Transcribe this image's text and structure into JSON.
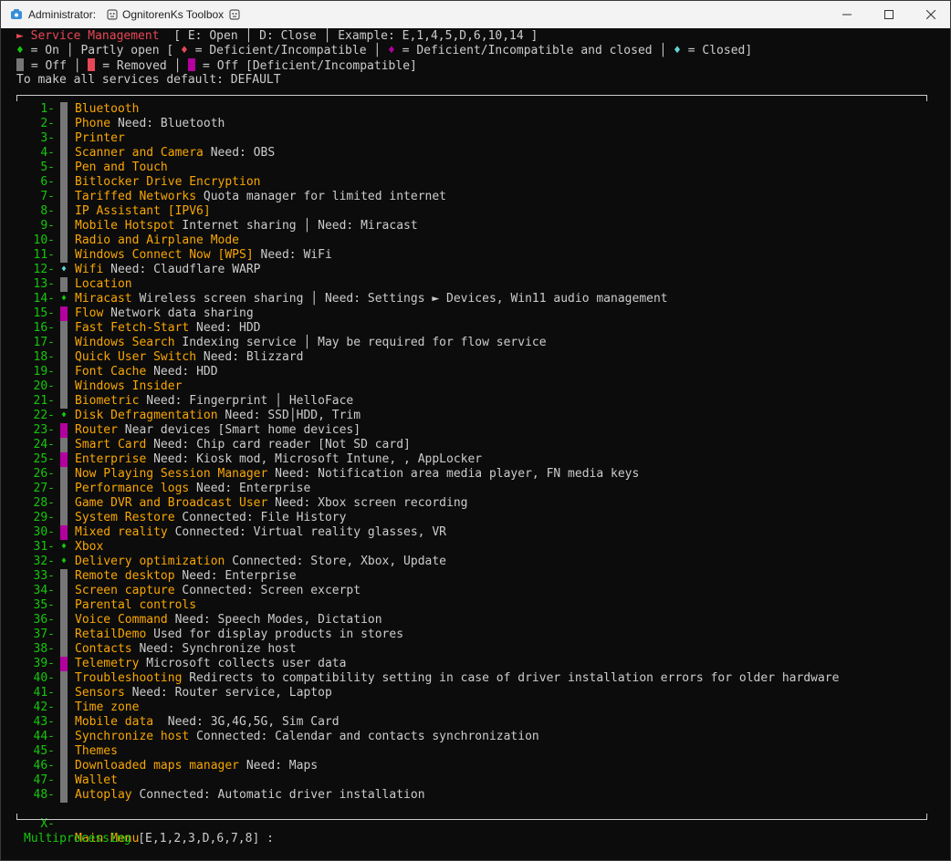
{
  "titlebar": {
    "admin_label": "Administrator:",
    "title": "OgnitorenKs Toolbox"
  },
  "header": {
    "arrow": "►",
    "title": "Service Management",
    "hint": "[ E: Open │ D: Close │ Example: E,1,4,5,D,6,10,14 ]",
    "legend1": {
      "on_sym": "♦",
      "on": "= On",
      "sep1": "│",
      "partly": "Partly open [",
      "def_sym": "♦",
      "def": "= Deficient/Incompatible",
      "sep2": "│",
      "defc_sym": "♦",
      "defc": "= Deficient/Incompatible and closed",
      "sep3": "│",
      "closed_sym": "♦",
      "closed": "= Closed]"
    },
    "legend2": {
      "off": "= Off",
      "sep1": "│",
      "removed": "= Removed",
      "sep2": "│",
      "offdef": "= Off [Deficient/Incompatible]"
    },
    "default_line": "To make all services default: DEFAULT"
  },
  "services": [
    {
      "num": "1-",
      "marker": "gray",
      "name": "Bluetooth",
      "desc": ""
    },
    {
      "num": "2-",
      "marker": "gray",
      "name": "Phone",
      "desc": " Need: Bluetooth"
    },
    {
      "num": "3-",
      "marker": "gray",
      "name": "Printer",
      "desc": ""
    },
    {
      "num": "4-",
      "marker": "gray",
      "name": "Scanner and Camera",
      "desc": " Need: OBS"
    },
    {
      "num": "5-",
      "marker": "gray",
      "name": "Pen and Touch",
      "desc": ""
    },
    {
      "num": "6-",
      "marker": "gray",
      "name": "Bitlocker Drive Encryption",
      "desc": ""
    },
    {
      "num": "7-",
      "marker": "gray",
      "name": "Tariffed Networks",
      "desc": " Quota manager for limited internet"
    },
    {
      "num": "8-",
      "marker": "gray",
      "name": "IP Assistant [IPV6]",
      "desc": ""
    },
    {
      "num": "9-",
      "marker": "gray",
      "name": "Mobile Hotspot",
      "desc": " Internet sharing │ Need: Miracast"
    },
    {
      "num": "10-",
      "marker": "gray",
      "name": "Radio and Airplane Mode",
      "desc": ""
    },
    {
      "num": "11-",
      "marker": "gray",
      "name": "Windows Connect Now [WPS]",
      "desc": " Need: WiFi"
    },
    {
      "num": "12-",
      "marker": "cyan",
      "name": "Wifi",
      "desc": " Need: Claudflare WARP"
    },
    {
      "num": "13-",
      "marker": "gray",
      "name": "Location",
      "desc": ""
    },
    {
      "num": "14-",
      "marker": "green",
      "name": "Miracast",
      "desc": " Wireless screen sharing │ Need: Settings ► Devices, Win11 audio management"
    },
    {
      "num": "15-",
      "marker": "mag",
      "name": "Flow",
      "desc": " Network data sharing"
    },
    {
      "num": "16-",
      "marker": "gray",
      "name": "Fast Fetch-Start",
      "desc": " Need: HDD"
    },
    {
      "num": "17-",
      "marker": "gray",
      "name": "Windows Search",
      "desc": " Indexing service │ May be required for flow service"
    },
    {
      "num": "18-",
      "marker": "gray",
      "name": "Quick User Switch",
      "desc": " Need: Blizzard"
    },
    {
      "num": "19-",
      "marker": "gray",
      "name": "Font Cache",
      "desc": " Need: HDD"
    },
    {
      "num": "20-",
      "marker": "gray",
      "name": "Windows Insider",
      "desc": ""
    },
    {
      "num": "21-",
      "marker": "gray",
      "name": "Biometric",
      "desc": " Need: Fingerprint │ HelloFace"
    },
    {
      "num": "22-",
      "marker": "green",
      "name": "Disk Defragmentation",
      "desc": " Need: SSD│HDD, Trim"
    },
    {
      "num": "23-",
      "marker": "mag",
      "name": "Router",
      "desc": " Near devices [Smart home devices]"
    },
    {
      "num": "24-",
      "marker": "gray",
      "name": "Smart Card",
      "desc": " Need: Chip card reader [Not SD card]"
    },
    {
      "num": "25-",
      "marker": "mag",
      "name": "Enterprise",
      "desc": " Need: Kiosk mod, Microsoft Intune, , AppLocker"
    },
    {
      "num": "26-",
      "marker": "gray",
      "name": "Now Playing Session Manager",
      "desc": " Need: Notification area media player, FN media keys"
    },
    {
      "num": "27-",
      "marker": "gray",
      "name": "Performance logs",
      "desc": " Need: Enterprise"
    },
    {
      "num": "28-",
      "marker": "gray",
      "name": "Game DVR and Broadcast User",
      "desc": " Need: Xbox screen recording"
    },
    {
      "num": "29-",
      "marker": "gray",
      "name": "System Restore",
      "desc": " Connected: File History"
    },
    {
      "num": "30-",
      "marker": "mag",
      "name": "Mixed reality",
      "desc": " Connected: Virtual reality glasses, VR"
    },
    {
      "num": "31-",
      "marker": "green",
      "name": "Xbox",
      "desc": ""
    },
    {
      "num": "32-",
      "marker": "green",
      "name": "Delivery optimization",
      "desc": " Connected: Store, Xbox, Update"
    },
    {
      "num": "33-",
      "marker": "gray",
      "name": "Remote desktop",
      "desc": " Need: Enterprise"
    },
    {
      "num": "34-",
      "marker": "gray",
      "name": "Screen capture",
      "desc": " Connected: Screen excerpt"
    },
    {
      "num": "35-",
      "marker": "gray",
      "name": "Parental controls",
      "desc": ""
    },
    {
      "num": "36-",
      "marker": "gray",
      "name": "Voice Command",
      "desc": " Need: Speech Modes, Dictation"
    },
    {
      "num": "37-",
      "marker": "gray",
      "name": "RetailDemo",
      "desc": " Used for display products in stores"
    },
    {
      "num": "38-",
      "marker": "gray",
      "name": "Contacts",
      "desc": " Need: Synchronize host"
    },
    {
      "num": "39-",
      "marker": "mag",
      "name": "Telemetry",
      "desc": " Microsoft collects user data"
    },
    {
      "num": "40-",
      "marker": "gray",
      "name": "Troubleshooting",
      "desc": " Redirects to compatibility setting in case of driver installation errors for older hardware"
    },
    {
      "num": "41-",
      "marker": "gray",
      "name": "Sensors",
      "desc": " Need: Router service, Laptop"
    },
    {
      "num": "42-",
      "marker": "gray",
      "name": "Time zone",
      "desc": ""
    },
    {
      "num": "43-",
      "marker": "gray",
      "name": "Mobile data",
      "desc": "  Need: 3G,4G,5G, Sim Card"
    },
    {
      "num": "44-",
      "marker": "gray",
      "name": "Synchronize host",
      "desc": " Connected: Calendar and contacts synchronization"
    },
    {
      "num": "45-",
      "marker": "gray",
      "name": "Themes",
      "desc": ""
    },
    {
      "num": "46-",
      "marker": "gray",
      "name": "Downloaded maps manager",
      "desc": " Need: Maps"
    },
    {
      "num": "47-",
      "marker": "gray",
      "name": "Wallet",
      "desc": ""
    },
    {
      "num": "48-",
      "marker": "gray",
      "name": "Autoplay",
      "desc": " Connected: Automatic driver installation"
    }
  ],
  "main_menu": {
    "num": "X-",
    "label": "Main Menu"
  },
  "prompt": {
    "label": "Multiprocessing",
    "value": "[E,1,2,3,D,6,7,8] :"
  }
}
